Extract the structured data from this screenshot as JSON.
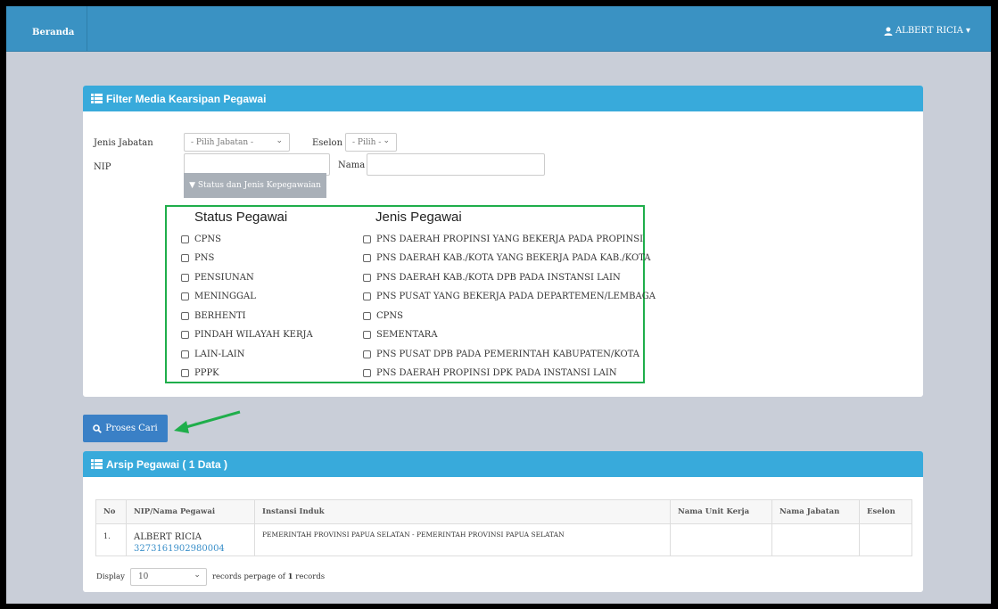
{
  "nav": {
    "brand": "Beranda",
    "user": "ALBERT RICIA",
    "user_caret": "▾"
  },
  "filter": {
    "title": "Filter Media Kearsipan Pegawai",
    "jenis_jabatan_label": "Jenis Jabatan",
    "jenis_jabatan_value": "- Pilih Jabatan -",
    "eselon_label": "Eselon",
    "eselon_value": "- Pilih -",
    "nip_label": "NIP",
    "nip_value": "",
    "nama_label": "Nama",
    "nama_value": "",
    "status_toggle": "▼ Status dan Jenis Kepegawaian",
    "status_heading": "Status Pegawai",
    "jenis_heading": "Jenis Pegawai",
    "status_items": [
      "CPNS",
      "PNS",
      "PENSIUNAN",
      "MENINGGAL",
      "BERHENTI",
      "PINDAH WILAYAH KERJA",
      "LAIN-LAIN",
      "PPPK"
    ],
    "jenis_items": [
      "PNS DAERAH PROPINSI YANG BEKERJA PADA PROPINSI",
      "PNS DAERAH KAB./KOTA YANG BEKERJA PADA KAB./KOTA",
      "PNS DAERAH KAB./KOTA DPB PADA INSTANSI LAIN",
      "PNS PUSAT YANG BEKERJA PADA DEPARTEMEN/LEMBAGA",
      "CPNS",
      "SEMENTARA",
      "PNS PUSAT DPB PADA PEMERINTAH KABUPATEN/KOTA",
      "PNS DAERAH PROPINSI DPK PADA INSTANSI LAIN"
    ]
  },
  "search_button": "Proses Cari",
  "arsip": {
    "title": "Arsip Pegawai ( 1 Data )",
    "columns": [
      "No",
      "NIP/Nama Pegawai",
      "Instansi Induk",
      "Nama Unit Kerja",
      "Nama Jabatan",
      "Eselon"
    ],
    "rows": [
      {
        "no": "1.",
        "name": "ALBERT RICIA",
        "nip": "3273161902980004",
        "instansi": "PEMERINTAH PROVINSI PAPUA SELATAN - PEMERINTAH PROVINSI PAPUA SELATAN",
        "unit_kerja": "",
        "jabatan": "",
        "eselon": ""
      }
    ],
    "display_label": "Display",
    "display_value": "10",
    "records_prefix": "records perpage of",
    "records_count": "1",
    "records_suffix": "records"
  },
  "colors": {
    "navbar": "#3a92c3",
    "panel_header": "#38aadb",
    "button": "#3a80c6",
    "highlight_box": "#1fae4b",
    "arrow": "#1fae4b",
    "link": "#3a8fc9"
  }
}
